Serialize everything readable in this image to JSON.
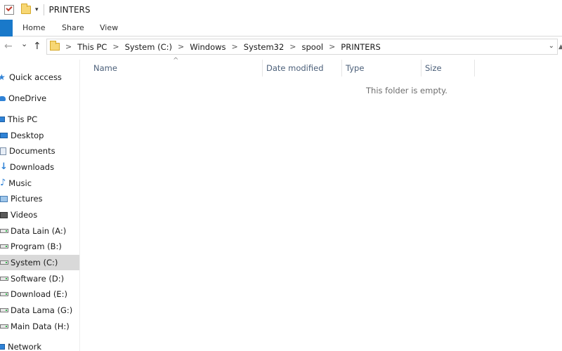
{
  "window": {
    "title": "PRINTERS",
    "quick_access_dropdown": "▾"
  },
  "ribbon": {
    "tabs": [
      "Home",
      "Share",
      "View"
    ]
  },
  "navigation": {
    "back_icon": "←",
    "forward_icon": "→",
    "recent_icon": "⌄",
    "up_icon": "↑"
  },
  "address_bar": {
    "breadcrumbs": [
      "This PC",
      "System (C:)",
      "Windows",
      "System32",
      "spool",
      "PRINTERS"
    ],
    "separator": ">",
    "dropdown_icon": "⌄"
  },
  "nav_pane": {
    "items": [
      {
        "label": "Quick access",
        "icon": "star-icon"
      },
      {
        "label": "OneDrive",
        "icon": "cloud-icon"
      },
      {
        "label": "This PC",
        "icon": "computer-icon"
      },
      {
        "label": "Desktop",
        "icon": "desktop-icon"
      },
      {
        "label": "Documents",
        "icon": "documents-icon"
      },
      {
        "label": "Downloads",
        "icon": "download-icon"
      },
      {
        "label": "Music",
        "icon": "music-icon"
      },
      {
        "label": "Pictures",
        "icon": "pictures-icon"
      },
      {
        "label": "Videos",
        "icon": "videos-icon"
      },
      {
        "label": "Data Lain (A:)",
        "icon": "drive-icon"
      },
      {
        "label": "Program (B:)",
        "icon": "drive-icon"
      },
      {
        "label": "System (C:)",
        "icon": "drive-icon",
        "selected": true
      },
      {
        "label": "Software (D:)",
        "icon": "drive-icon"
      },
      {
        "label": "Download (E:)",
        "icon": "drive-icon"
      },
      {
        "label": "Data Lama (G:)",
        "icon": "drive-icon"
      },
      {
        "label": "Main Data (H:)",
        "icon": "drive-icon"
      },
      {
        "label": "Network",
        "icon": "network-icon"
      }
    ]
  },
  "content": {
    "columns": [
      "Name",
      "Date modified",
      "Type",
      "Size"
    ],
    "sort_indicator": "^",
    "empty_message": "This folder is empty."
  },
  "colors": {
    "accent": "#1979ca",
    "selected_bg": "#d9d9d9",
    "header_text": "#4c607a"
  }
}
